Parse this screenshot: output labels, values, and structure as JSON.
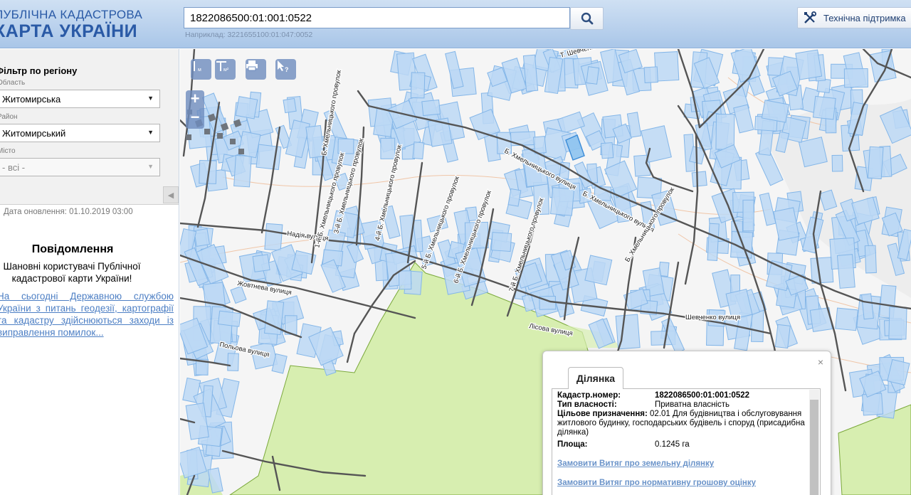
{
  "header": {
    "logo_top": "ПУБЛІЧНА КАДАСТРОВА",
    "logo_bottom": "КАРТА УКРАЇНИ",
    "search_value": "1822086500:01:001:0522",
    "search_hint": "Наприклад: 3221655100:01:047:0052",
    "support_label": "Технічна підтримка",
    "icons": {
      "search": "search-icon",
      "support": "tools-icon"
    }
  },
  "filter": {
    "title": "Фільтр по регіону",
    "oblast_label": "Область",
    "oblast_value": "Житомирська",
    "rayon_label": "Район",
    "rayon_value": "Житомирський",
    "misto_label": "Місто",
    "misto_value": "- всі -"
  },
  "update_date": "Дата оновлення: 01.10.2019 03:00",
  "messages": {
    "title": "Повідомлення",
    "text": "Шановні користувачі Публічної кадастрової карти України!",
    "link": "На сьогодні Державною службою України з питань геодезії, картографії та кадастру здійснюються заходи із виправлення помилок..."
  },
  "map": {
    "tools": [
      "ruler-icon",
      "area-ruler-icon",
      "print-icon",
      "identify-icon"
    ],
    "tool_labels": {
      "ruler": "м",
      "area": "м²",
      "identify": "?"
    },
    "zoom_in": "+",
    "zoom_out": "−",
    "street_labels": [
      {
        "text": "Надія вулиця"
      },
      {
        "text": "Жовтнева вулиця"
      },
      {
        "text": "Польова вулиця"
      },
      {
        "text": "Лісова вулиця"
      },
      {
        "text": "Шевченко вулиця"
      },
      {
        "text": "Б. Хмельницького вулиця"
      },
      {
        "text": "Б. Хмельницького вулиця"
      },
      {
        "text": "Б. Хмельницького провулок"
      },
      {
        "text": "1-й Б. Хмельницького провулок"
      },
      {
        "text": "3-й Б. Хмельницького провулок"
      },
      {
        "text": "4-й Б. Хмельницького провулок"
      },
      {
        "text": "5-й Б. Хмельницького провулок"
      },
      {
        "text": "6-й Б. Хмельницького провулок"
      },
      {
        "text": "7-й Б. Хмельницького провулок"
      },
      {
        "text": "Б. Хмельницького провулок"
      },
      {
        "text": "Т. Шевченка п..."
      }
    ],
    "colors": {
      "parcel_fill": "#bcd8f5",
      "parcel_stroke": "#7fb2e6",
      "forest": "#d7eeb0",
      "road": "#444444"
    }
  },
  "popup": {
    "tab": "Ділянка",
    "close": "×",
    "rows": [
      {
        "key": "Кадастр.номер:",
        "value": "1822086500:01:001:0522"
      },
      {
        "key": "Тип власності:",
        "value": "Приватна власність"
      },
      {
        "key": "Цільове призначення:",
        "value": "02.01 Для будівництва і обслуговування житлового будинку, господарських будівель і споруд (присадибна ділянка)"
      },
      {
        "key": "Площа:",
        "value": "0.1245 га"
      }
    ],
    "link1": "Замовити Витяг про земельну ділянку",
    "link2": "Замовити Витяг про нормативну грошову оцінку"
  }
}
